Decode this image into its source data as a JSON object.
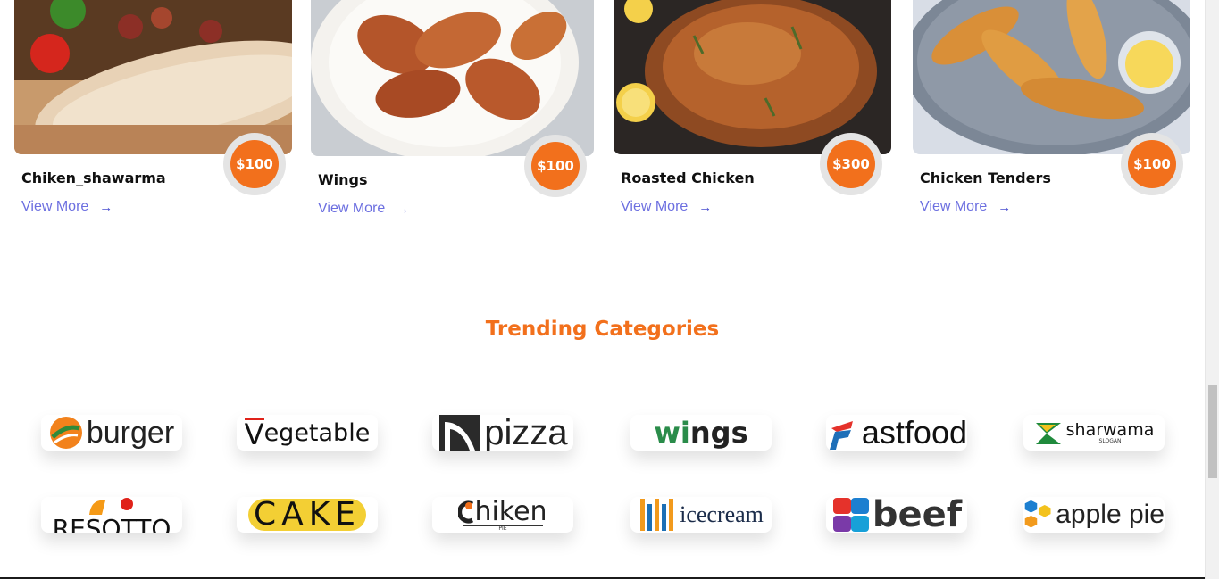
{
  "products": [
    {
      "name": "Chiken_shawarma",
      "price": "$100",
      "link": "View More",
      "arrow": "→"
    },
    {
      "name": "Wings",
      "price": "$100",
      "link": "View More",
      "arrow": "→"
    },
    {
      "name": "Roasted Chicken",
      "price": "$300",
      "link": "View More",
      "arrow": "→"
    },
    {
      "name": "Chicken Tenders",
      "price": "$100",
      "link": "View More",
      "arrow": "→"
    }
  ],
  "trending": {
    "title": "Trending Categories",
    "categories": [
      {
        "label": "burger"
      },
      {
        "label": "egetable",
        "initial": "V"
      },
      {
        "label": "pizza"
      },
      {
        "label": "ngs",
        "prefix": "wi"
      },
      {
        "label": "astfood"
      },
      {
        "label": "sharwama",
        "sub": "SLOGAN"
      },
      {
        "label": "RESOTTO"
      },
      {
        "label": "CAKE"
      },
      {
        "label": "hiken",
        "sub": "PIE"
      },
      {
        "label": "icecream"
      },
      {
        "label": "beef"
      },
      {
        "label": "apple pie"
      }
    ]
  },
  "colors": {
    "accent": "#f2701c",
    "link": "#6c6fe0"
  }
}
